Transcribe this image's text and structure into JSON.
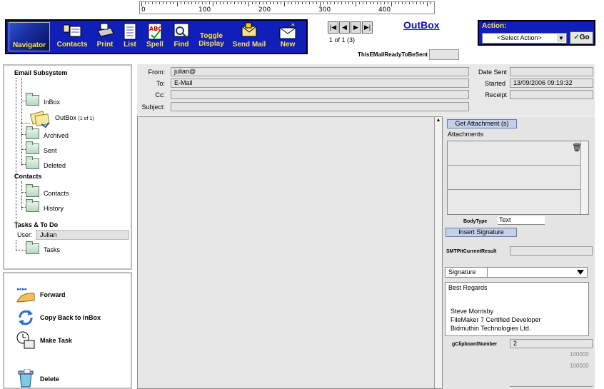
{
  "ruler": {
    "marks": [
      "0",
      "100",
      "200",
      "300",
      "400"
    ]
  },
  "toolbar": {
    "buttons": [
      {
        "label": "Navigator",
        "icon": "navigator-icon"
      },
      {
        "label": "Contacts",
        "icon": "contacts-icon"
      },
      {
        "label": "Print",
        "icon": "printer-icon"
      },
      {
        "label": "List",
        "icon": "list-icon"
      },
      {
        "label": "Spell",
        "icon": "spellcheck-icon"
      },
      {
        "label": "Find",
        "icon": "find-icon"
      },
      {
        "label_line1": "Toggle",
        "label_line2": "Display",
        "icon": "toggle-icon"
      },
      {
        "label": "Send Mail",
        "icon": "send-mail-icon"
      },
      {
        "label": "New",
        "icon": "new-mail-icon"
      }
    ]
  },
  "record_nav": {
    "count": "1 of 1 (3)"
  },
  "page_title": "OutBox",
  "ready_label": "ThisEMailReadyToBeSent",
  "action": {
    "label": "Action:",
    "select_value": "<Select Action>",
    "go_label": "Go"
  },
  "tree": {
    "email_header": "Email Subsystem",
    "items": [
      {
        "label": "InBox"
      },
      {
        "label": "OutBox",
        "count": "(1 of 1)"
      },
      {
        "label": "Archived"
      },
      {
        "label": "Sent"
      },
      {
        "label": "Deleted"
      }
    ],
    "contacts_header": "Contacts",
    "contacts_items": [
      {
        "label": "Contacts"
      },
      {
        "label": "History"
      }
    ],
    "tasks_header": "Tasks & To Do",
    "user_label": "User:",
    "user_value": "Julian",
    "tasks_items": [
      {
        "label": "Tasks"
      }
    ]
  },
  "actions": [
    {
      "label": "Forward",
      "icon": "forward-icon"
    },
    {
      "label": "Copy Back to InBox",
      "icon": "copy-back-icon"
    },
    {
      "label": "Make Task",
      "icon": "make-task-icon"
    },
    {
      "label": "Delete",
      "icon": "trash-icon"
    }
  ],
  "header": {
    "from_label": "From:",
    "from_value": "julian@",
    "to_label": "To:",
    "to_value": "E-Mail",
    "cc_label": "Cc:",
    "cc_value": "",
    "subject_label": "Subject:",
    "subject_value": "",
    "date_sent_label": "Date Sent",
    "date_sent_value": "",
    "started_label": "Started",
    "started_value": "13/09/2006 09:19:32",
    "receipt_label": "Receipt",
    "receipt_value": ""
  },
  "right": {
    "get_attachment": "Get Attachment (s)",
    "attachments_label": "Attachments",
    "body_type_label": "BodyType",
    "body_type_value": "Text",
    "insert_signature": "Insert Signature",
    "smtp_label": "SMTPItCurrentResult",
    "smtp_value": "",
    "signature_label": "Signature",
    "signature_lines": [
      "Best Regards",
      "",
      "",
      "Steve Morrisby",
      "FileMaker 7 Certified Developer",
      "Bidmuthin Technologies Ltd."
    ],
    "clipboard_label": "gClipboardNumber",
    "clipboard_value": "2",
    "num1": "100000",
    "num2": "100000"
  }
}
